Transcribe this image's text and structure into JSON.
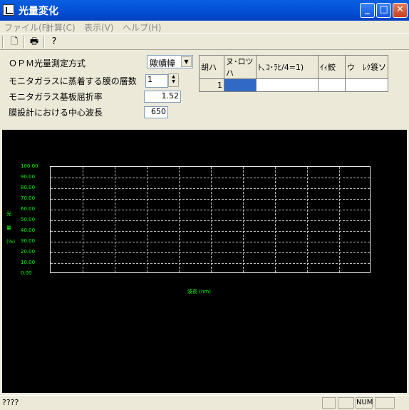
{
  "window": {
    "title": "光量変化"
  },
  "menu": [
    "ファイル(F)",
    "計算(C)",
    "表示(V)",
    "ヘルプ(H)"
  ],
  "form": {
    "method_label": "ＯＰＭ光量測定方式",
    "method_value": "歟幘幃",
    "layers_label": "モニタガラスに蒸着する膜の層数",
    "layers_value": "1",
    "refr_label": "モニタガラス基板屈折率",
    "refr_value": "1.52",
    "wavelength_label": "膜設計における中心波長",
    "wavelength_value": "650"
  },
  "table": {
    "headers": [
      "胡ハ",
      "ヌ･ロツハ",
      "ﾄ､ｺ･ﾗﾋ/4=1)",
      "ｲｨ鮫",
      "ウ　ﾚｸ簑ソ"
    ],
    "rows": [
      [
        "1",
        "",
        "",
        "",
        ""
      ]
    ]
  },
  "chart_data": {
    "type": "line",
    "y_ticks": [
      "100.00",
      "90.00",
      "80.00",
      "70.00",
      "60.00",
      "50.00",
      "40.00",
      "30.00",
      "20.00",
      "10.00",
      "0.00"
    ],
    "ylabel": [
      "光",
      "量",
      "(%)"
    ],
    "xlabel": "波長 (nm)",
    "ylim": [
      0,
      100
    ],
    "grid": true,
    "series": []
  },
  "status": {
    "text": "????",
    "num": "NUM"
  }
}
